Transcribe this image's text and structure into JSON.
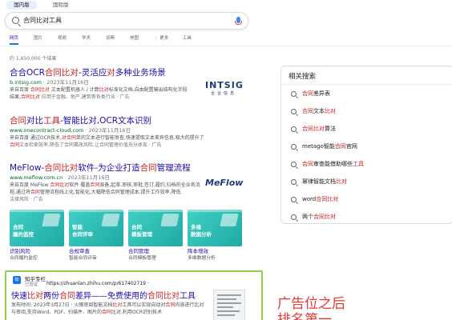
{
  "top_tabs": {
    "active": "国内版",
    "intl": "国际版"
  },
  "search": {
    "query": "合同比对工具"
  },
  "nav": {
    "tabs": [
      "网页",
      "图片",
      "视频",
      "学术",
      "词典",
      "地图",
      "⋮ 更多",
      "工具"
    ]
  },
  "stats": "约 1,650,000 个结果",
  "results": [
    {
      "title_pre": "合合OCR",
      "title_hl": "合同比对",
      "title_mid": "-灵活应",
      "title_hl2": "对",
      "title_post": "多种业务场景",
      "url": "b.intsig.com",
      "date": " · 2023年11月16日",
      "desc1_pre": "来自百度 ",
      "desc1_hl": "合同比对",
      "desc1_mid": " 文本配置机器人 / 计算",
      "desc1_hl2": "比对",
      "desc1_post": "标准化文档,自由配置输出结构化字段",
      "desc2_pre": "结果,",
      "desc2_hl": "合同比对",
      "desc2_post": " 应用于金融、地产,建筑等各类行业 · 广告",
      "logo_big": "INTSIG",
      "logo_small": "合合信息"
    },
    {
      "title_hl": "合同",
      "title_mid": "对比",
      "title_hl2": "工具",
      "title_post": "-智能比对,OCR文本识别",
      "url": "www.onecontract-cloud.com",
      "date": " · 2023年11月16日",
      "desc1_pre": "来自百度 通过OCR技术,",
      "desc1_hl": "对合同",
      "desc1_post": "单的文本进行智能审查,快速提取文本差异信息,极大的提升了",
      "desc2_hl": "合同",
      "desc2_post": "文本检索效率,降低了合同篡改风险,让合同管理价值充分体现 · 广告"
    },
    {
      "title_pre": "MeFlow-",
      "title_hl": "合同比对",
      "title_mid": "软件-为企业打造",
      "title_hl2": "合同",
      "title_post": "管理流程",
      "url": "www.meflow.com.cn",
      "date": " · 2023年11月16日",
      "desc1_pre": "来自百度 MeFlow ",
      "desc1_hl": "合同比对",
      "desc1_mid": "软件 覆盖",
      "desc1_hl2": "合同",
      "desc1_post": "准备,起草,审核,审批,签订,履约,归档的全业务流",
      "desc2_pre": "程,通过将",
      "desc2_hl": "合同",
      "desc2_post": "管理流程线上化,智能化,大幅降低合同管理成本,提升工作效率,降低",
      "desc3_pre": "法律风险 · 广告",
      "logo_text": "MeFlow"
    }
  ],
  "cards": [
    {
      "title1": "合同",
      "title2": "履约监控",
      "label": "识别风险",
      "sub": "合同履约监控"
    },
    {
      "title1": "智能",
      "title2": "合同评审",
      "label": "合规审查",
      "sub": "智能合同评审"
    },
    {
      "title1": "合同",
      "title2": "模板管理",
      "label": "合同管理",
      "sub": "合同模板管理"
    },
    {
      "title1": "多维",
      "title2": "数据分析",
      "label": "降本增效",
      "sub": "多维数据分析"
    }
  ],
  "zhihu": {
    "icon": "知",
    "name": "知乎专栏",
    "verified": "已验证",
    "url": "https://zhuanlan.zhihu.com/p/617402719  ·",
    "title_pre": "快速",
    "title_hl": "比对",
    "title_mid": "两份",
    "title_hl2": "合同",
    "title_mid2": "差异——免费使用的",
    "title_hl3": "合同比对",
    "title_post": "工具",
    "desc1_pre": "发布时间: 2023年3月27日 · 火眼审阅智能文档",
    "desc1_hl": "比对",
    "desc1_mid": "工具可以实现自动对",
    "desc1_hl2": "合同",
    "desc1_post": "内容进行比对",
    "desc2_pre": "与审阅,支持Word、PDF、扫描件、图片的",
    "desc2_hl": "合同",
    "desc2_mid": "比对,利用OCR识别技术"
  },
  "annotation": {
    "line1": "广告位之后",
    "line2": "排名第一"
  },
  "related": {
    "title": "相关搜索",
    "items": [
      {
        "pre": "",
        "hl": "合同",
        "post": "差异表"
      },
      {
        "pre": "",
        "hl": "合同",
        "post": "文本",
        "hl2": "比对"
      },
      {
        "pre": "",
        "hl": "合同比对",
        "post": "算法"
      },
      {
        "pre": "metago智能",
        "hl": "合同",
        "post": "官网"
      },
      {
        "pre": "",
        "hl": "合同",
        "post": "审查能借助哪些",
        "hl2": "工具"
      },
      {
        "pre": "幂律智能文档",
        "hl": "比对",
        "post": ""
      },
      {
        "pre": "word",
        "hl": "合同比对",
        "post": ""
      },
      {
        "pre": "两个",
        "hl": "合同比对",
        "post": ""
      }
    ]
  },
  "colors": {
    "link": "#1a0dab",
    "highlight": "#c5221f",
    "url": "#006621",
    "zhihu_border": "#8bd24a",
    "annotation": "#e53935"
  }
}
